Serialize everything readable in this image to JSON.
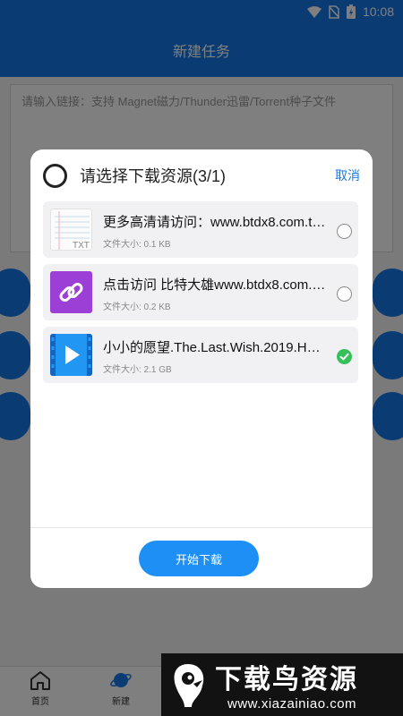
{
  "status_bar": {
    "time": "10:08",
    "icons": [
      "wifi-icon",
      "no-sim-icon",
      "battery-charging-icon"
    ]
  },
  "header": {
    "title": "新建任务"
  },
  "link_input": {
    "placeholder": "请输入链接：支持 Magnet磁力/Thunder迅雷/Torrent种子文件"
  },
  "tabbar": {
    "items": [
      {
        "label": "首页",
        "icon": "home-icon"
      },
      {
        "label": "新建",
        "icon": "planet-icon"
      }
    ]
  },
  "dialog": {
    "title": "请选择下载资源(3/1)",
    "cancel_label": "取消",
    "files": [
      {
        "name": "更多高清请访问：www.btdx8.com.t…",
        "size": "文件大小: 0.1 KB",
        "icon": "txt-file-icon",
        "icon_text": "TXT",
        "selected": false
      },
      {
        "name": "点击访问 比特大雄www.btdx8.com.…",
        "size": "文件大小: 0.2 KB",
        "icon": "link-file-icon",
        "selected": false
      },
      {
        "name": "小小的愿望.The.Last.Wish.2019.HD…",
        "size": "文件大小: 2.1 GB",
        "icon": "video-file-icon",
        "selected": true
      }
    ],
    "start_label": "开始下载"
  },
  "watermark": {
    "title": "下载鸟资源",
    "url": "www.xiazainiao.com"
  },
  "colors": {
    "primary": "#1479e6",
    "start_button": "#1e90f5",
    "selected": "#36c05a",
    "link_icon": "#9b3fd6",
    "video_icon": "#2196f3"
  }
}
